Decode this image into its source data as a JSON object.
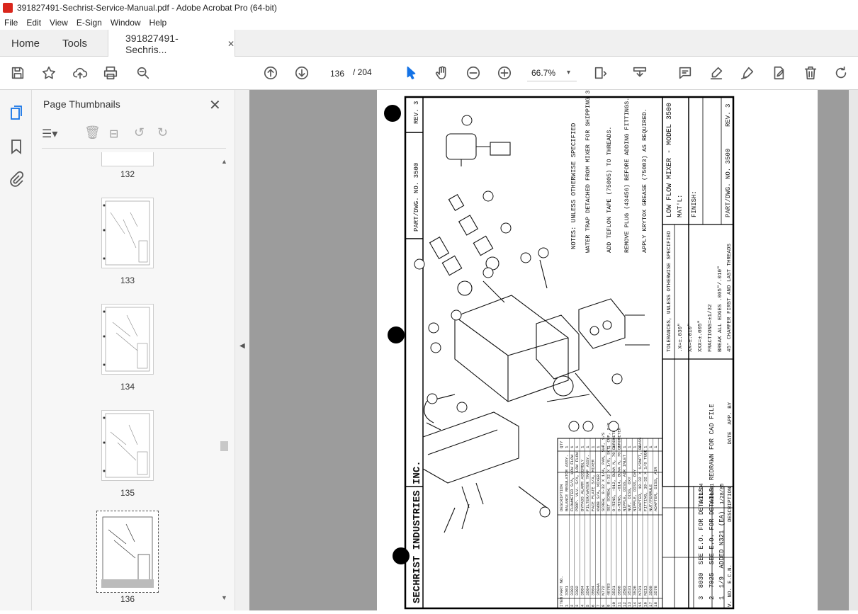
{
  "window": {
    "title": "391827491-Sechrist-Service-Manual.pdf - Adobe Acrobat Pro (64-bit)"
  },
  "menu": [
    "File",
    "Edit",
    "View",
    "E-Sign",
    "Window",
    "Help"
  ],
  "tabs": {
    "home": "Home",
    "tools": "Tools",
    "doc": "391827491-Sechris...",
    "close": "✕"
  },
  "nav": {
    "current_page": "136",
    "total": "/ 204",
    "zoom": "66.7%"
  },
  "panel": {
    "title": "Page Thumbnails",
    "close": "✕"
  },
  "thumbnails": [
    "132",
    "133",
    "134",
    "135",
    "136"
  ],
  "drawing": {
    "company": "SECHRIST INDUSTRIES INC.",
    "part_no_label": "PART/DWG. NO. 3500",
    "rev": "REV. 3",
    "title": "LOW FLOW MIXER - MODEL 3500",
    "matl": "MAT'L:",
    "finish": "FINISH:",
    "notes_title": "NOTES: UNLESS OTHERWISE SPECIFIED",
    "notes": [
      "WATER TRAP DETACHED FROM MIXER FOR SHIPPING 3500A.",
      "ADD TEFLON TAPE (75005) TO THREADS.",
      "REMOVE PLUG (43456) BEFORE ADDING FITTINGS.",
      "APPLY KRYTOX GREASE (75003) AS REQUIRED."
    ],
    "tolerances": [
      "TOLERANCES, UNLESS OTHERWISE SPECIFIED",
      ".X=±.030\"",
      "XX=±.010\"",
      "XXX=±.005\"",
      "FRACTIONS=±1/32",
      "BREAK ALL EDGES .005\"/.010\"",
      "45° CHAMFER FIRST AND LAST THREADS"
    ],
    "ecn": [
      {
        "v": "3",
        "no": "8030",
        "desc": "SEE E.O. FOR DETAILS",
        "date": "6/23/94"
      },
      {
        "v": "2",
        "no": "7925",
        "desc": "SEE E.O. FOR DETAILS, REDRAWN FOR CAD FILE",
        "date": "3/20/91"
      },
      {
        "v": "1",
        "no": "1/9",
        "desc": "ADDED N321 (EA)",
        "date": "1/28/85"
      }
    ],
    "ecn_headers": [
      "V. NO.",
      "E.C.N.",
      "DESCRIPTION",
      "DATE",
      "APP. BY"
    ],
    "bom_headers": [
      "ITEM",
      "PART NO.",
      "DESCRIPTION",
      "QTY"
    ],
    "bom": [
      [
        "1",
        "3301",
        "BALANCE REGULATOR ASSY.",
        "1"
      ],
      [
        "2",
        "3303",
        "FLOWMETER S/A, LOW FLOW",
        "1"
      ],
      [
        "3",
        "3302",
        "PROP. VLV. S/A, LOW FLOW",
        "1"
      ],
      [
        "4",
        "3504",
        "BYPASS ALARM ASSEMBLY",
        "1"
      ],
      [
        "5",
        "3504",
        "FILTER/WATER TRAP ASSY.",
        "1"
      ],
      [
        "6",
        "3504",
        "FACE PLATE S/A, MIXER",
        "1"
      ],
      [
        "7",
        "3504A",
        "KNOB S/A, MIXER",
        "1"
      ],
      [
        "8",
        "N772",
        "SCREW, 8-32 X 1/4, PAN, SLT, S/S",
        "4"
      ],
      [
        "9",
        "48783",
        "SET SCREW, 8-32 X 1/8, SCT, CUP, S/S",
        "2"
      ],
      [
        "10",
        "3521",
        "O-RING, -012, BUNA N, 70 DUROMETER",
        "2"
      ],
      [
        "11",
        "3508",
        "O-RING, -014, BUNA N, 70 DUROMETER",
        "2"
      ],
      [
        "12",
        "3503",
        "NIPPLE, DISS, AIR INLET",
        "1"
      ],
      [
        "13",
        "3531",
        "NUT, DISS, OXY",
        "1"
      ],
      [
        "14",
        "3526",
        "NIPPLE, DISS, OXY",
        "1"
      ],
      [
        "15",
        "N721",
        "ADAPTER, 10-32 X 1/8NPT, BRASS",
        "1"
      ],
      [
        "16",
        "N211",
        "FITTING, 10-32 X 1/8 TUBE",
        "1"
      ],
      [
        "17",
        "3560",
        "NUT/FERRULE",
        "1"
      ],
      [
        "18",
        "3578",
        "ADAPTER, DISS, AIR",
        "1"
      ]
    ]
  },
  "colors": {
    "accent": "#1473e6",
    "doc_bg": "#9c9c9c"
  }
}
